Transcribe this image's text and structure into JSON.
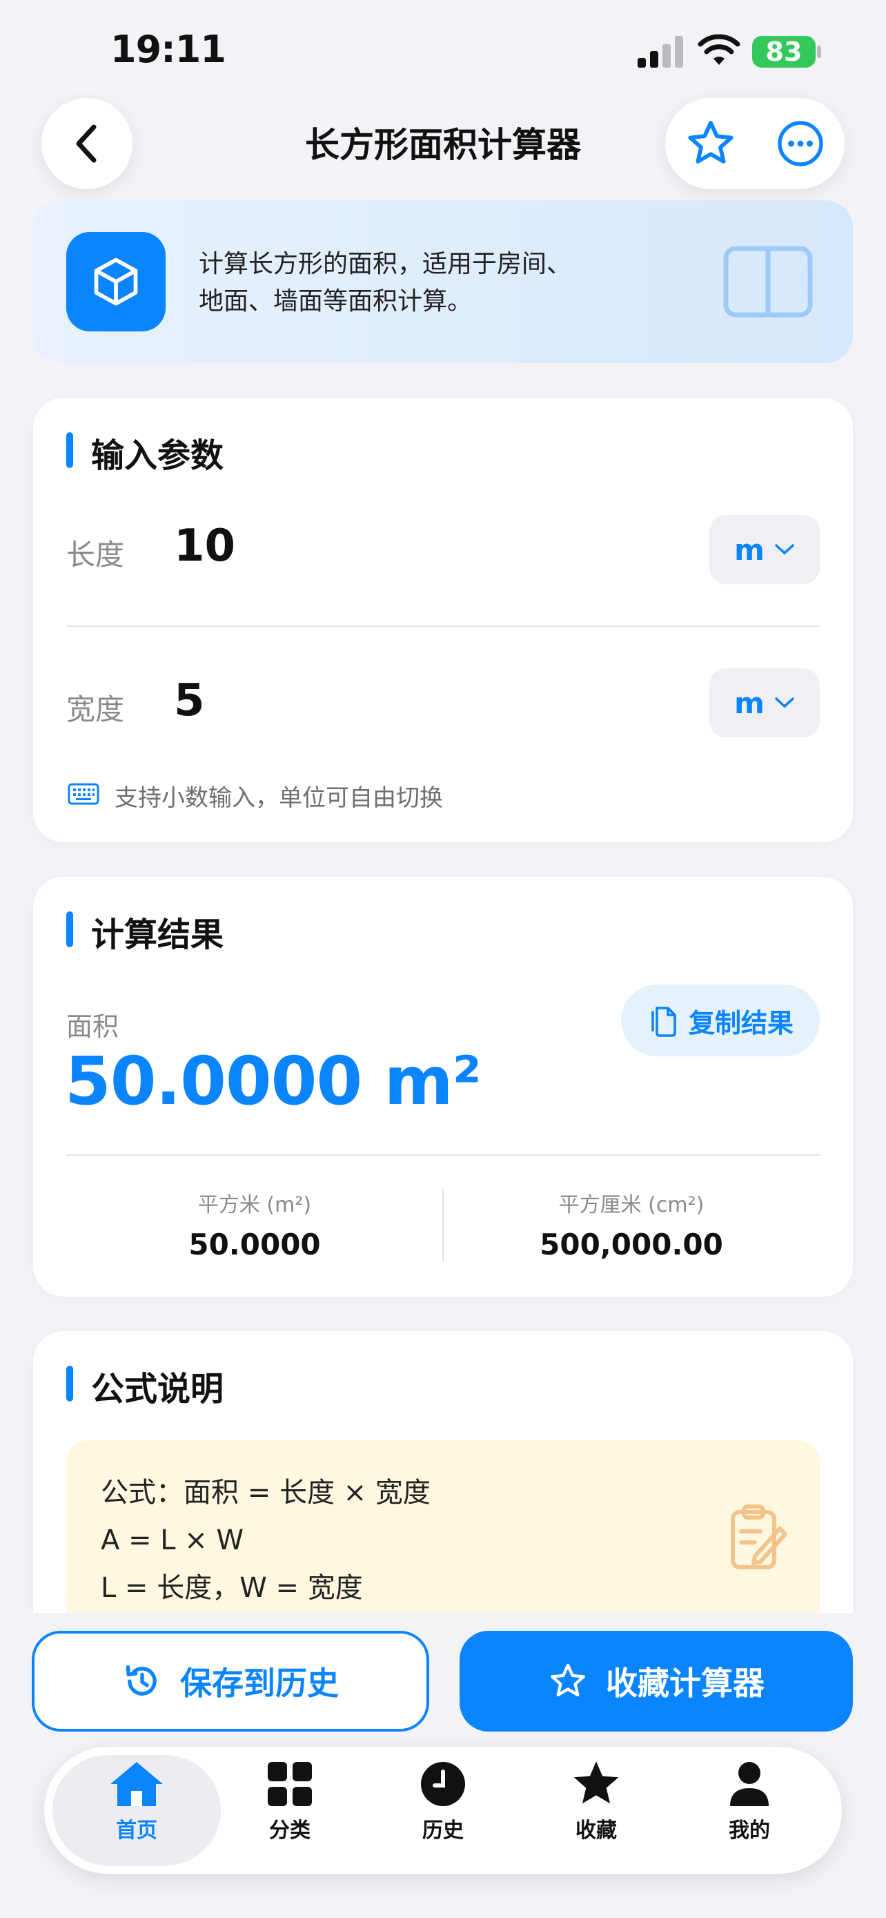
{
  "status_bar": {
    "time": "19:11",
    "battery": "83"
  },
  "nav": {
    "title": "长方形面积计算器"
  },
  "intro": {
    "line1": "计算长方形的面积，适用于房间、",
    "line2": "地面、墙面等面积计算。"
  },
  "inputs": {
    "title": "输入参数",
    "length": {
      "label": "长度",
      "value": "10",
      "unit": "m"
    },
    "width": {
      "label": "宽度",
      "value": "5",
      "unit": "m"
    },
    "hint": "支持小数输入，单位可自由切换"
  },
  "result": {
    "title": "计算结果",
    "label": "面积",
    "value": "50.0000 m²",
    "copy_label": "复制结果",
    "conversions": [
      {
        "label": "平方米 (m²)",
        "value": "50.0000"
      },
      {
        "label": "平方厘米 (cm²)",
        "value": "500,000.00"
      }
    ]
  },
  "formula": {
    "title": "公式说明",
    "lines": [
      "公式：面积 = 长度 × 宽度",
      "A = L × W",
      "L = 长度，W = 宽度"
    ]
  },
  "actions": {
    "save_label": "保存到历史",
    "favorite_label": "收藏计算器"
  },
  "tabbar": {
    "items": [
      {
        "label": "首页",
        "icon": "home-icon",
        "active": true
      },
      {
        "label": "分类",
        "icon": "grid-icon"
      },
      {
        "label": "历史",
        "icon": "clock-icon"
      },
      {
        "label": "收藏",
        "icon": "star-icon"
      },
      {
        "label": "我的",
        "icon": "person-icon"
      }
    ]
  },
  "colors": {
    "accent": "#0A84FF",
    "battery": "#34C759",
    "formula_bg": "#FFF8E1"
  }
}
